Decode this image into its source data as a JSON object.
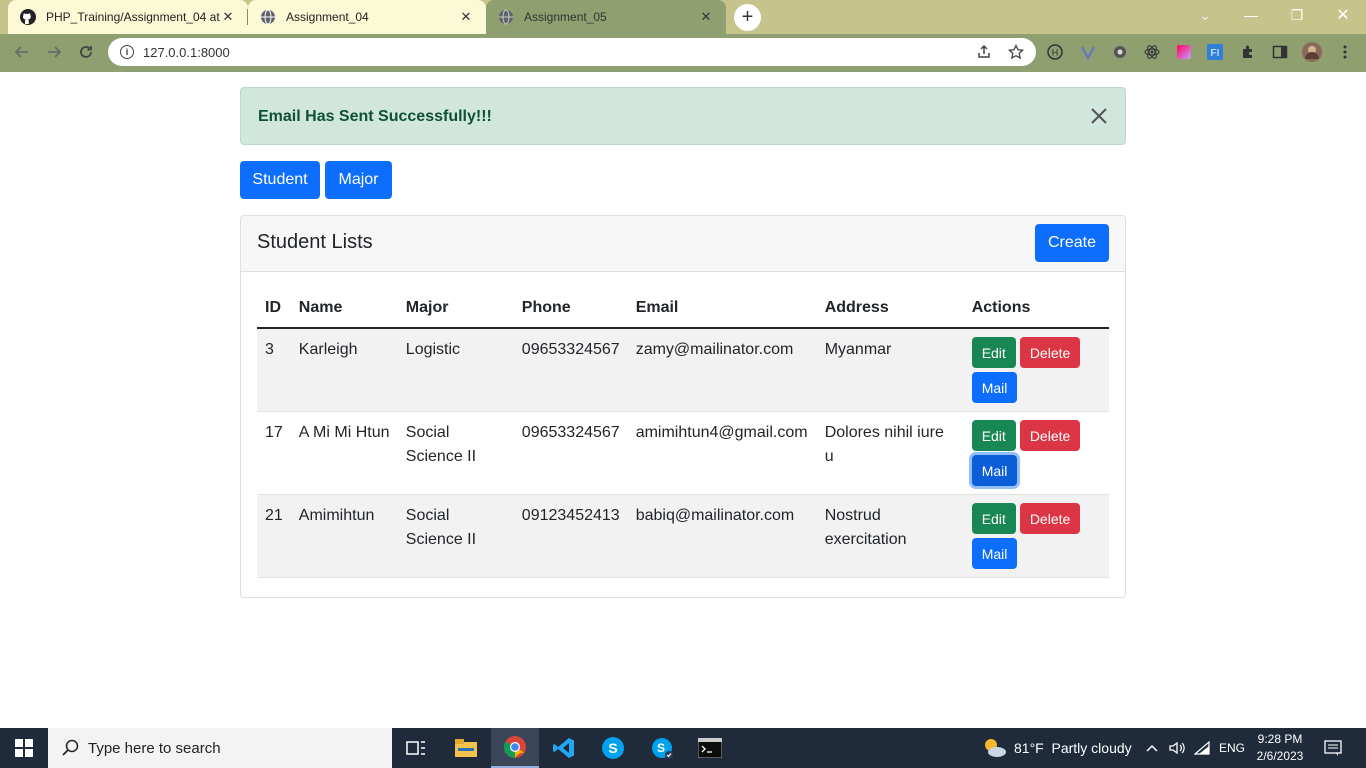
{
  "browser": {
    "tabs": [
      {
        "title": "PHP_Training/Assignment_04 at r",
        "close": "✕",
        "icon": "github-icon"
      },
      {
        "title": "Assignment_04",
        "close": "✕",
        "icon": "globe-icon"
      },
      {
        "title": "Assignment_05",
        "close": "✕",
        "icon": "globe-icon"
      }
    ],
    "new_tab": "+",
    "url": "127.0.0.1:8000",
    "window_controls": {
      "chevron": "⌄",
      "minimize": "—",
      "restore": "❐",
      "close": "✕"
    }
  },
  "alert": {
    "message": "Email Has Sent Successfully!!!",
    "color_bg": "#d1e7dd",
    "color_text": "#0f5132"
  },
  "nav": {
    "student_label": "Student",
    "major_label": "Major"
  },
  "card": {
    "title": "Student Lists",
    "create_label": "Create"
  },
  "table": {
    "headers": {
      "id": "ID",
      "name": "Name",
      "major": "Major",
      "phone": "Phone",
      "email": "Email",
      "address": "Address",
      "actions": "Actions"
    },
    "rows": [
      {
        "id": "3",
        "name": "Karleigh",
        "major": "Logistic",
        "phone": "09653324567",
        "email": "zamy@mailinator.com",
        "address": "Myanmar",
        "edit": "Edit",
        "delete": "Delete",
        "mail": "Mail"
      },
      {
        "id": "17",
        "name": "A Mi Mi Htun",
        "major": "Social Science II",
        "phone": "09653324567",
        "email": "amimihtun4@gmail.com",
        "address": "Dolores nihil iure u",
        "edit": "Edit",
        "delete": "Delete",
        "mail": "Mail"
      },
      {
        "id": "21",
        "name": "Amimihtun",
        "major": "Social Science II",
        "phone": "09123452413",
        "email": "babiq@mailinator.com",
        "address": "Nostrud exercitation",
        "edit": "Edit",
        "delete": "Delete",
        "mail": "Mail"
      }
    ]
  },
  "colors": {
    "primary": "#0d6efd",
    "success": "#198754",
    "danger": "#dc3545"
  },
  "taskbar": {
    "search_placeholder": "Type here to search",
    "weather": "81°F  Partly cloudy",
    "language": "ENG",
    "time": "9:28 PM",
    "date": "2/6/2023"
  }
}
